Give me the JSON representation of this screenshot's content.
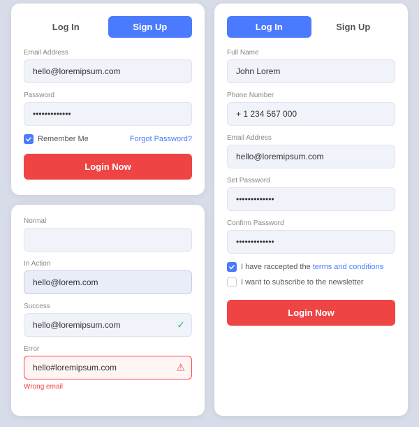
{
  "leftCard": {
    "tabs": [
      {
        "label": "Log In",
        "active": false
      },
      {
        "label": "Sign Up",
        "active": true
      }
    ],
    "emailLabel": "Email Address",
    "emailValue": "hello@loremipsum.com",
    "passwordLabel": "Password",
    "passwordValue": "•••••••••••••",
    "rememberLabel": "Remember Me",
    "forgotLabel": "Forgot Password?",
    "loginButton": "Login Now"
  },
  "statesCard": {
    "normalLabel": "Normal",
    "normalValue": "",
    "inActionLabel": "In Action",
    "inActionValue": "hello@lorem.com",
    "successLabel": "Success",
    "successValue": "hello@loremipsum.com",
    "errorLabel": "Error",
    "errorValue": "hello#loremipsum.com",
    "errorMsg": "Wrong email"
  },
  "rightCard": {
    "tabs": [
      {
        "label": "Log In",
        "active": true
      },
      {
        "label": "Sign Up",
        "active": false
      }
    ],
    "fullNameLabel": "Full Name",
    "fullNameValue": "John Lorem",
    "phoneLabel": "Phone Number",
    "phoneValue": "+ 1 234 567 000",
    "emailLabel": "Email Address",
    "emailValue": "hello@loremipsum.com",
    "setPasswordLabel": "Set Password",
    "setPasswordValue": "•••••••••••••",
    "confirmPasswordLabel": "Confirm Password",
    "confirmPasswordValue": "•••••••••••••",
    "terms1": "I have raccepted the ",
    "termsLink": "terms and conditions",
    "newsletter": "I want to subscribe to the newsletter",
    "loginButton": "Login Now"
  }
}
